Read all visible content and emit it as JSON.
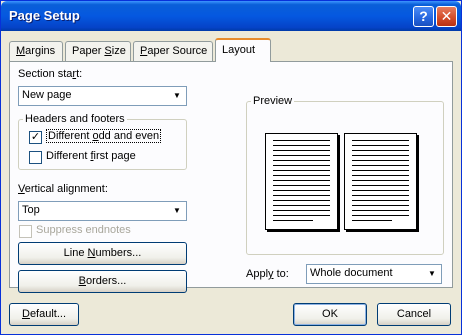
{
  "window": {
    "title": "Page Setup",
    "help_glyph": "?",
    "close_glyph": "✕"
  },
  "tabs": [
    {
      "label": "Margins",
      "hotkey": "M",
      "rest": "argins"
    },
    {
      "label": "Paper Size",
      "pre": "Paper ",
      "hotkey": "S",
      "rest": "ize"
    },
    {
      "label": "Paper Source",
      "pre": "",
      "hotkey": "P",
      "rest": "aper Source"
    },
    {
      "label": "Layout",
      "pre": "Layout",
      "hotkey": "",
      "rest": ""
    }
  ],
  "section_start": {
    "label_pre": "Section sta",
    "label_hotkey": "r",
    "label_post": "t:",
    "value": "New page"
  },
  "headers_footers": {
    "legend": "Headers and footers",
    "odd_even": {
      "pre": "Different ",
      "hotkey": "o",
      "post": "dd and even",
      "checked": true
    },
    "first_page": {
      "pre": "Different ",
      "hotkey": "f",
      "post": "irst page",
      "checked": false
    }
  },
  "vertical_alignment": {
    "label_hotkey": "V",
    "label_post": "ertical alignment:",
    "value": "Top"
  },
  "suppress_endnotes": {
    "label": "Suppress endnotes",
    "checked": false,
    "enabled": false
  },
  "buttons": {
    "line_numbers": {
      "pre": "Line ",
      "hotkey": "N",
      "post": "umbers..."
    },
    "borders": {
      "pre": "",
      "hotkey": "B",
      "post": "orders..."
    },
    "default": {
      "pre": "",
      "hotkey": "D",
      "post": "efault..."
    },
    "ok": "OK",
    "cancel": "Cancel"
  },
  "preview": {
    "legend": "Preview"
  },
  "apply_to": {
    "label_pre": "Appl",
    "label_hotkey": "y",
    "label_post": " to:",
    "value": "Whole document"
  },
  "colors": {
    "title_bar": "#0558e0",
    "dialog_face": "#ece9d8",
    "tab_accent": "#e68b2c"
  }
}
